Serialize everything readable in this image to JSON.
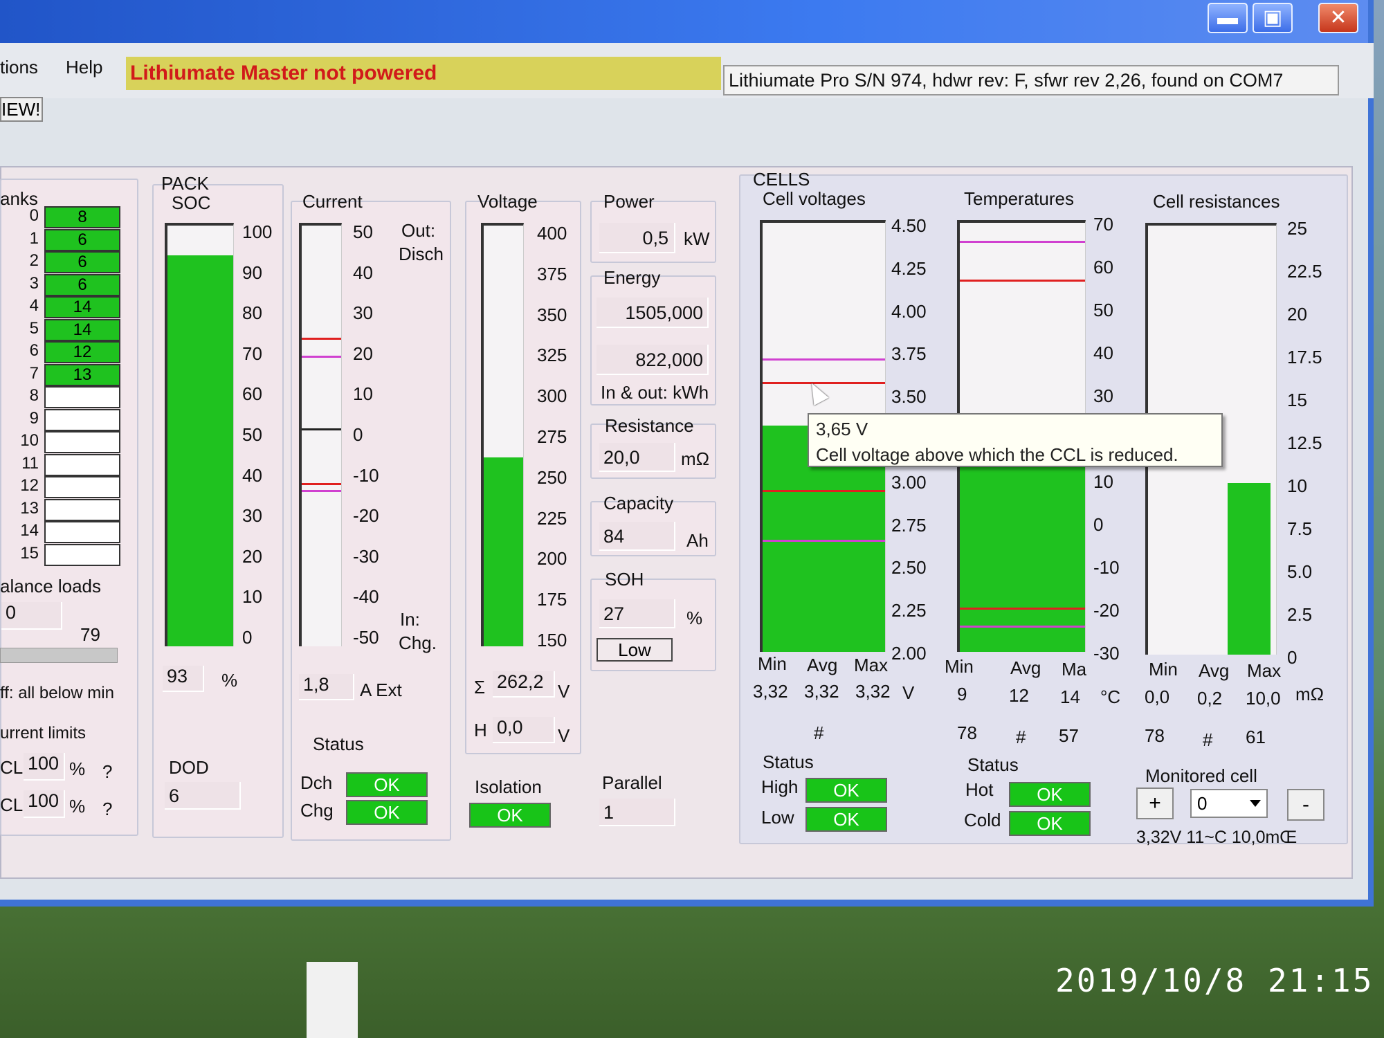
{
  "menu": {
    "options": "tions",
    "help": "Help"
  },
  "warning": "Lithiumate Master not powered",
  "device_info": "Lithiumate Pro S/N 974, hdwr rev: F, sfwr rev 2,26, found on COM7",
  "new_tab": "IEW!",
  "window_buttons": {
    "min": "▬",
    "max": "▣",
    "close": "✕"
  },
  "banks": {
    "title": "anks",
    "rows": [
      {
        "idx": "0",
        "val": "8",
        "on": true
      },
      {
        "idx": "1",
        "val": "6",
        "on": true
      },
      {
        "idx": "2",
        "val": "6",
        "on": true
      },
      {
        "idx": "3",
        "val": "6",
        "on": true
      },
      {
        "idx": "4",
        "val": "14",
        "on": true
      },
      {
        "idx": "5",
        "val": "14",
        "on": true
      },
      {
        "idx": "6",
        "val": "12",
        "on": true
      },
      {
        "idx": "7",
        "val": "13",
        "on": true
      },
      {
        "idx": "8",
        "val": "",
        "on": false
      },
      {
        "idx": "9",
        "val": "",
        "on": false
      },
      {
        "idx": "10",
        "val": "",
        "on": false
      },
      {
        "idx": "11",
        "val": "",
        "on": false
      },
      {
        "idx": "12",
        "val": "",
        "on": false
      },
      {
        "idx": "13",
        "val": "",
        "on": false
      },
      {
        "idx": "14",
        "val": "",
        "on": false
      },
      {
        "idx": "15",
        "val": "",
        "on": false
      }
    ],
    "balance_loads_label": "alance loads",
    "balance_value": "0",
    "balance_max": "79",
    "balance_off_label": "ff: all below min",
    "current_limits_label": "urrent limits",
    "dcl_label": "CL",
    "dcl_value": "100",
    "dcl_unit": "%",
    "dcl_q": "?",
    "ccl_label": "CL",
    "ccl_value": "100",
    "ccl_unit": "%",
    "ccl_q": "?"
  },
  "pack": {
    "title": "PACK",
    "soc_label": "SOC",
    "soc_ticks": [
      "100",
      "90",
      "80",
      "70",
      "60",
      "50",
      "40",
      "30",
      "20",
      "10",
      "0"
    ],
    "soc_value": "93",
    "soc_unit": "%",
    "soc_level": 93,
    "dod_label": "DOD",
    "dod_value": "6"
  },
  "current": {
    "title": "Current",
    "ticks": [
      "50",
      "40",
      "30",
      "20",
      "10",
      "0",
      "-10",
      "-20",
      "-30",
      "-40",
      "-50"
    ],
    "out_label": "Out:",
    "disch_label": "Disch",
    "in_label": "In:",
    "chg_label": "Chg.",
    "value": "1,8",
    "unit": "A Ext",
    "status_label": "Status",
    "dch_label": "Dch",
    "dch_status": "OK",
    "chg_status_label": "Chg",
    "chg_status": "OK"
  },
  "voltage": {
    "title": "Voltage",
    "ticks": [
      "400",
      "375",
      "350",
      "325",
      "300",
      "275",
      "250",
      "225",
      "200",
      "175",
      "150"
    ],
    "sum_label": "Σ",
    "sum_value": "262,2",
    "sum_unit": "V",
    "h_label": "H",
    "h_value": "0,0",
    "h_unit": "V",
    "isolation_label": "Isolation",
    "isolation_status": "OK",
    "level": 262.2
  },
  "power": {
    "title": "Power",
    "value": "0,5",
    "unit": "kW",
    "energy_label": "Energy",
    "energy_in": "1505,000",
    "energy_out": "822,000",
    "energy_unit": "In & out: kWh",
    "resistance_label": "Resistance",
    "resistance_value": "20,0",
    "resistance_unit": "mΩ",
    "capacity_label": "Capacity",
    "capacity_value": "84",
    "capacity_unit": "Ah",
    "soh_label": "SOH",
    "soh_value": "27",
    "soh_unit": "%",
    "soh_status": "Low",
    "parallel_label": "Parallel",
    "parallel_value": "1"
  },
  "cells": {
    "title": "CELLS",
    "voltages_label": "Cell voltages",
    "v_ticks": [
      "4.50",
      "4.25",
      "4.00",
      "3.75",
      "3.50",
      "3.25",
      "3.00",
      "2.75",
      "2.50",
      "2.25",
      "2.00"
    ],
    "min_label": "Min",
    "avg_label": "Avg",
    "max_label": "Max",
    "v_min": "3,32",
    "v_avg": "3,32",
    "v_max": "3,32",
    "v_unit": "V",
    "v_hash": "#",
    "v_level": 3.32,
    "status_label": "Status",
    "high_label": "High",
    "high_status": "OK",
    "low_label": "Low",
    "low_status": "OK",
    "temps_label": "Temperatures",
    "t_ticks": [
      "70",
      "60",
      "50",
      "40",
      "30",
      "20",
      "10",
      "0",
      "-10",
      "-20",
      "-30"
    ],
    "t_min": "9",
    "t_avg": "12",
    "t_max": "14",
    "t_unit": "°C",
    "t_max_label": "Ma",
    "t_num_min": "78",
    "t_hash": "#",
    "t_num_max": "57",
    "t_level": 14,
    "t_status_label": "Status",
    "hot_label": "Hot",
    "hot_status": "OK",
    "cold_label": "Cold",
    "cold_status": "OK",
    "res_label": "Cell resistances",
    "r_ticks": [
      "25",
      "22.5",
      "20",
      "17.5",
      "15",
      "12.5",
      "10",
      "7.5",
      "5.0",
      "2.5",
      "0"
    ],
    "r_min": "0,0",
    "r_avg": "0,2",
    "r_max": "10,0",
    "r_unit": "mΩ",
    "r_num_min": "78",
    "r_hash": "#",
    "r_num_max": "61",
    "r_level": 10.0,
    "monitored_label": "Monitored cell",
    "monitored_value": "0",
    "plus": "+",
    "minus": "-",
    "monitored_readout": "3,32V  11~C 10,0mŒ"
  },
  "tooltip": {
    "line1": "3,65 V",
    "line2": "Cell voltage above which the CCL is reduced."
  },
  "timestamp": "2019/10/8  21:15",
  "colors": {
    "green": "#1fc21f",
    "red_limit": "#e02020",
    "magenta_limit": "#d040d0",
    "warning_bg": "#d8d25a"
  }
}
